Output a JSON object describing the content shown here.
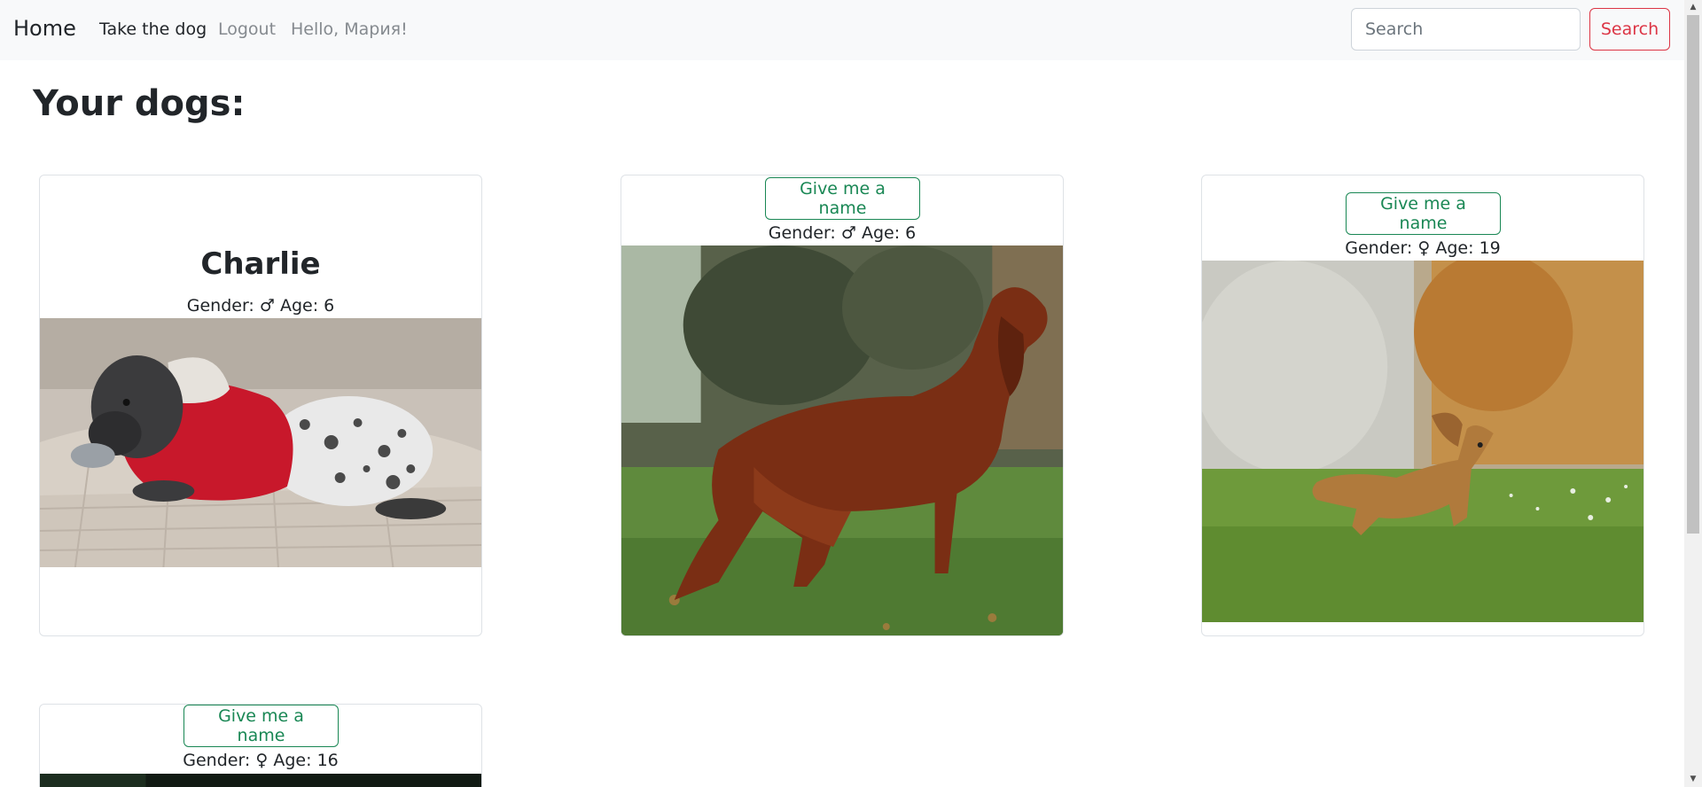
{
  "navbar": {
    "brand": "Home",
    "links": [
      {
        "label": "Take the dog"
      },
      {
        "label": "Logout"
      },
      {
        "label": "Hello, Мария!"
      }
    ],
    "search": {
      "placeholder": "Search",
      "value": "",
      "button_label": "Search"
    }
  },
  "page": {
    "title": "Your dogs:"
  },
  "labels": {
    "gender": "Gender:",
    "age": "Age:",
    "name_button": "Give me a name"
  },
  "dogs": [
    {
      "name": "Charlie",
      "gender_symbol": "♂",
      "gender": "male",
      "age": "6",
      "photo": "shar-pei in red hoodie on couch"
    },
    {
      "name": "",
      "gender_symbol": "♂",
      "gender": "male",
      "age": "6",
      "photo": "irish setter standing on grass"
    },
    {
      "name": "",
      "gender_symbol": "♀",
      "gender": "female",
      "age": "19",
      "photo": "dachshund running on grass"
    },
    {
      "name": "",
      "gender_symbol": "♀",
      "gender": "female",
      "age": "16",
      "photo": "dark photo"
    }
  ],
  "colors": {
    "navbar_bg": "#f8f9fa",
    "danger": "#dc3545",
    "success": "#198754",
    "text": "#212529",
    "muted": "#858a8f"
  }
}
